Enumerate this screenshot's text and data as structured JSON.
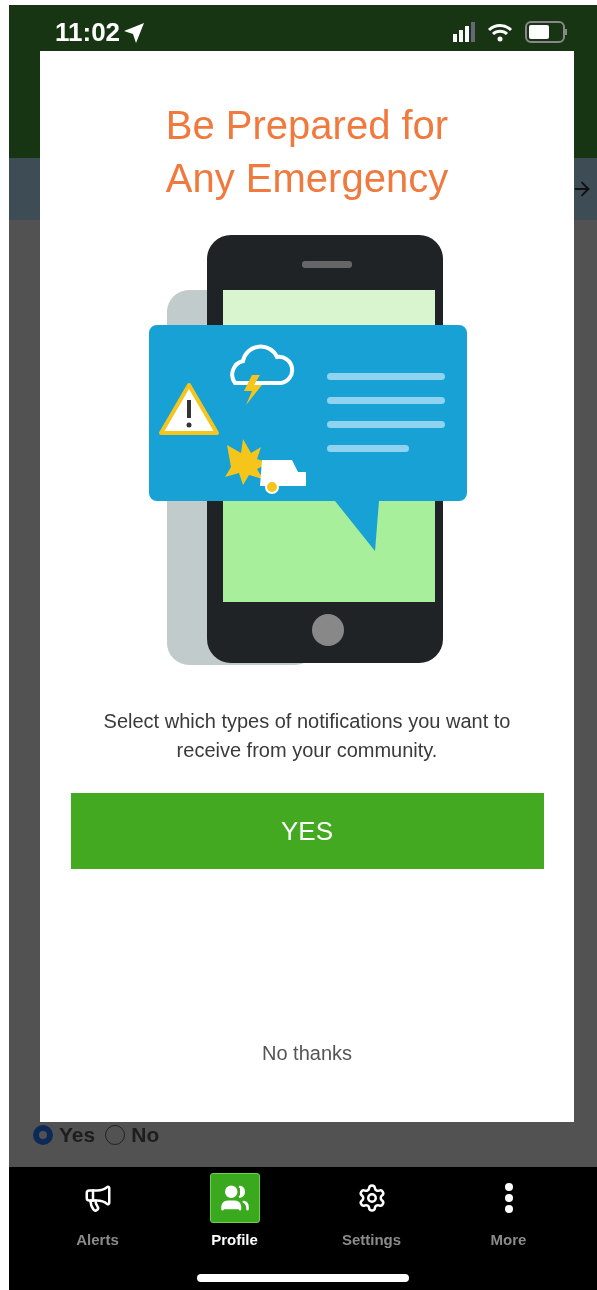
{
  "status_bar": {
    "time": "11:02"
  },
  "form": {
    "radio_options": [
      {
        "label": "Yes",
        "selected": true
      },
      {
        "label": "No",
        "selected": false
      }
    ]
  },
  "modal": {
    "title": "Be Prepared for Any Emergency",
    "message": "Select which types of notifications you want to receive from your community.",
    "primary_button": "YES",
    "secondary_link": "No thanks"
  },
  "tab_bar": [
    {
      "kind": "alerts",
      "label": "Alerts",
      "selected": false
    },
    {
      "kind": "profile",
      "label": "Profile",
      "selected": true
    },
    {
      "kind": "settings",
      "label": "Settings",
      "selected": false
    },
    {
      "kind": "more",
      "label": "More",
      "selected": false
    }
  ]
}
